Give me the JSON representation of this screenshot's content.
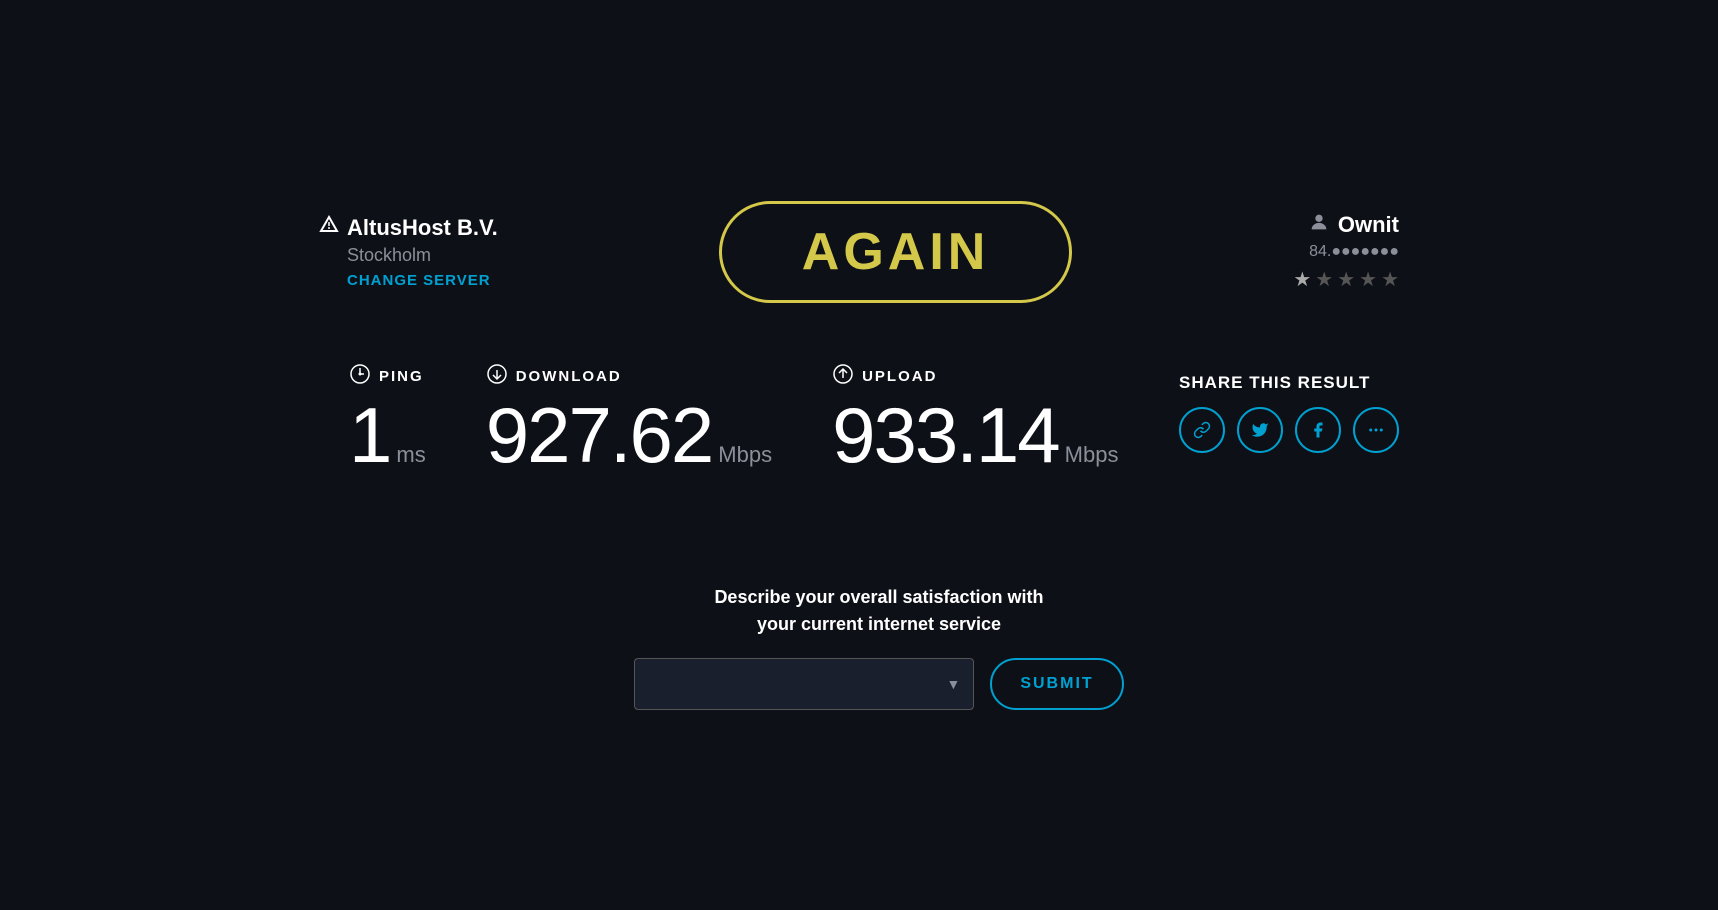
{
  "server": {
    "name": "AltusHost B.V.",
    "location": "Stockholm",
    "change_label": "CHANGE SERVER"
  },
  "again_button": {
    "label": "AGAIN"
  },
  "user": {
    "name": "Ownit",
    "ip_masked": "84.●●●●●●●",
    "stars": [
      1,
      0,
      0,
      0,
      0
    ],
    "star_filled_count": 1
  },
  "ping": {
    "label": "PING",
    "value": "1",
    "unit": "ms"
  },
  "download": {
    "label": "DOWNLOAD",
    "value": "927.62",
    "unit": "Mbps"
  },
  "upload": {
    "label": "UPLOAD",
    "value": "933.14",
    "unit": "Mbps"
  },
  "share": {
    "title": "SHARE THIS RESULT",
    "icons": [
      "link",
      "twitter",
      "facebook",
      "more"
    ]
  },
  "survey": {
    "question_line1": "Describe your overall satisfaction with",
    "question_line2": "your current internet service",
    "dropdown_placeholder": "",
    "submit_label": "SUBMIT"
  },
  "colors": {
    "accent_yellow": "#d4c84a",
    "accent_blue": "#00a0d1",
    "bg": "#0d1117",
    "text_muted": "#8a8f9a"
  }
}
